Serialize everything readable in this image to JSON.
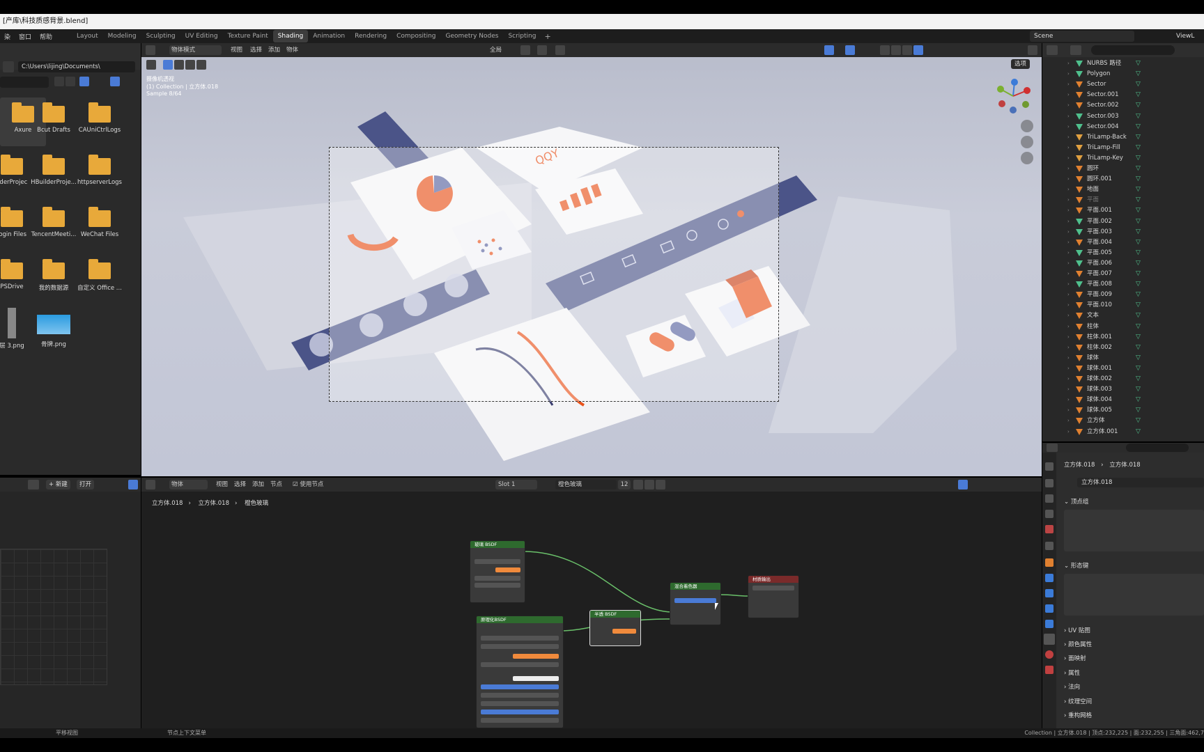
{
  "window": {
    "title": "[产库\\科技质感背景.blend]"
  },
  "menubar": {
    "menus": [
      "染",
      "窗口",
      "帮助"
    ],
    "workspaces": [
      "Layout",
      "Modeling",
      "Sculpting",
      "UV Editing",
      "Texture Paint",
      "Shading",
      "Animation",
      "Rendering",
      "Compositing",
      "Geometry Nodes",
      "Scripting"
    ],
    "active_workspace": "Shading",
    "scene": "Scene",
    "view_layer": "ViewL"
  },
  "file_browser": {
    "path": "C:\\Users\\lijing\\Documents\\",
    "items": [
      {
        "label": "Axure",
        "type": "folder",
        "selected": true
      },
      {
        "label": "Bcut Drafts",
        "type": "folder"
      },
      {
        "label": "CAUniCtrlLogs",
        "type": "folder"
      },
      {
        "label": "ilderProjec",
        "type": "folder"
      },
      {
        "label": "HBuilderProje...",
        "type": "folder"
      },
      {
        "label": "httpserverLogs",
        "type": "folder"
      },
      {
        "label": "login Files",
        "type": "folder"
      },
      {
        "label": "TencentMeeti...",
        "type": "folder"
      },
      {
        "label": "WeChat Files",
        "type": "folder"
      },
      {
        "label": "PSDrive",
        "type": "folder"
      },
      {
        "label": "我的数据源",
        "type": "folder"
      },
      {
        "label": "自定义 Office ...",
        "type": "folder"
      },
      {
        "label": "层 3.png",
        "type": "image"
      },
      {
        "label": "骨牌.png",
        "type": "image"
      }
    ]
  },
  "viewport": {
    "mode": "物体模式",
    "menus": [
      "视图",
      "选择",
      "添加",
      "物体"
    ],
    "transform": "全局",
    "options": "选项",
    "overlay_lines": [
      "摄像机透视",
      "(1) Collection | 立方体.018",
      "Sample 8/64"
    ]
  },
  "outliner": {
    "rows": [
      {
        "name": "NURBS 路径",
        "icon": "curve"
      },
      {
        "name": "Polygon",
        "icon": "curve"
      },
      {
        "name": "Sector",
        "icon": "mesh"
      },
      {
        "name": "Sector.001",
        "icon": "mesh"
      },
      {
        "name": "Sector.002",
        "icon": "mesh"
      },
      {
        "name": "Sector.003",
        "icon": "curve"
      },
      {
        "name": "Sector.004",
        "icon": "curve"
      },
      {
        "name": "TriLamp-Back",
        "icon": "light"
      },
      {
        "name": "TriLamp-Fill",
        "icon": "light"
      },
      {
        "name": "TriLamp-Key",
        "icon": "light"
      },
      {
        "name": "圆环",
        "icon": "mesh"
      },
      {
        "name": "圆环.001",
        "icon": "mesh"
      },
      {
        "name": "地面",
        "icon": "mesh"
      },
      {
        "name": "平面",
        "icon": "mesh",
        "dim": true
      },
      {
        "name": "平面.001",
        "icon": "mesh"
      },
      {
        "name": "平面.002",
        "icon": "curve"
      },
      {
        "name": "平面.003",
        "icon": "curve"
      },
      {
        "name": "平面.004",
        "icon": "mesh"
      },
      {
        "name": "平面.005",
        "icon": "curve"
      },
      {
        "name": "平面.006",
        "icon": "curve"
      },
      {
        "name": "平面.007",
        "icon": "mesh"
      },
      {
        "name": "平面.008",
        "icon": "curve"
      },
      {
        "name": "平面.009",
        "icon": "mesh"
      },
      {
        "name": "平面.010",
        "icon": "mesh"
      },
      {
        "name": "文本",
        "icon": "text"
      },
      {
        "name": "柱体",
        "icon": "mesh"
      },
      {
        "name": "柱体.001",
        "icon": "mesh"
      },
      {
        "name": "柱体.002",
        "icon": "mesh"
      },
      {
        "name": "球体",
        "icon": "mesh"
      },
      {
        "name": "球体.001",
        "icon": "mesh"
      },
      {
        "name": "球体.002",
        "icon": "mesh"
      },
      {
        "name": "球体.003",
        "icon": "mesh"
      },
      {
        "name": "球体.004",
        "icon": "mesh"
      },
      {
        "name": "球体.005",
        "icon": "mesh"
      },
      {
        "name": "立方体",
        "icon": "mesh"
      },
      {
        "name": "立方体.001",
        "icon": "mesh"
      }
    ]
  },
  "properties": {
    "breadcrumb_object": "立方体.018",
    "breadcrumb_mesh": "立方体.018",
    "mesh_name": "立方体.018",
    "panels_open": [
      "顶点组",
      "形态键"
    ],
    "panels_closed": [
      "UV 贴图",
      "颜色属性",
      "面映射",
      "属性",
      "法向",
      "纹理空间",
      "重构网格"
    ]
  },
  "node_editor": {
    "menus": [
      "物体",
      "视图",
      "选择",
      "添加",
      "节点"
    ],
    "use_nodes": "使用节点",
    "slot": "Slot 1",
    "material": "橙色玻璃",
    "users": "12",
    "breadcrumb": [
      "立方体.018",
      "立方体.018",
      "橙色玻璃"
    ],
    "image_new": "新建",
    "image_open": "打开",
    "nodes": {
      "glass": "玻璃 BSDF",
      "principled": "原理化BSDF",
      "diffuse": "半透 BSDF",
      "mix": "混合着色器",
      "output": "材质输出"
    }
  },
  "statusbar": {
    "left": "平移视图",
    "mid": "节点上下文菜单",
    "right": "Collection | 立方体.018 | 顶点:232,225 | 面:232,255 | 三角面:462,7"
  },
  "colors": {
    "accent": "#4a7bd6",
    "orange": "#f08a3c",
    "node_green": "#2e6a2e",
    "node_red": "#7a2a2a"
  }
}
